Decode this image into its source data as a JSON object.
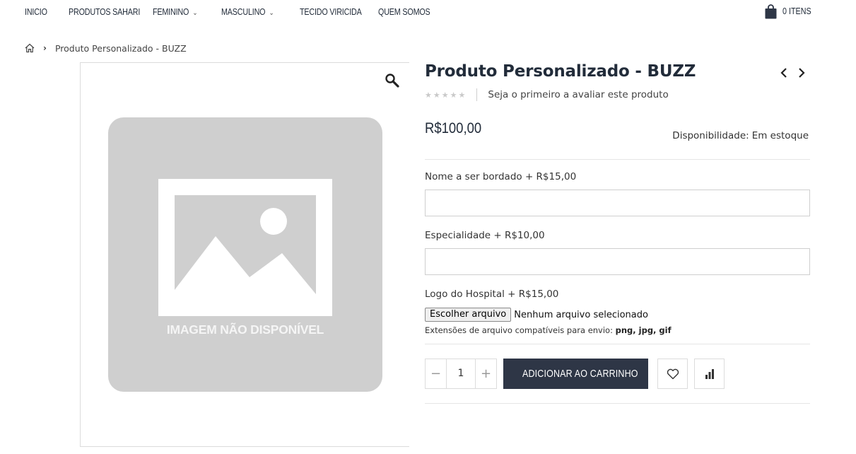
{
  "nav": {
    "items": [
      {
        "label": "INICIO",
        "dropdown": false
      },
      {
        "label": "PRODUTOS SAHARI",
        "dropdown": false
      },
      {
        "label": "FEMININO",
        "dropdown": true
      },
      {
        "label": "MASCULINO",
        "dropdown": true
      },
      {
        "label": "TECIDO VIRICIDA",
        "dropdown": false
      },
      {
        "label": "QUEM SOMOS",
        "dropdown": false
      }
    ],
    "cart_label": "0 ITENS",
    "cart_icon": "shopping-bag-icon"
  },
  "breadcrumb": {
    "home_icon": "home-icon",
    "current": "Produto Personalizado - BUZZ"
  },
  "gallery": {
    "zoom_icon": "magnifier-icon",
    "placeholder_text": "IMAGEM NÃO DISPONÍVEL"
  },
  "product": {
    "title": "Produto Personalizado - BUZZ",
    "rating_stars": 0,
    "rating_max": 5,
    "review_link": "Seja o primeiro a avaliar este produto",
    "price": "R$100,00",
    "availability_label": "Disponibilidade:",
    "availability_value": "Em estoque"
  },
  "options": {
    "name_label": "Nome a ser bordado + R$15,00",
    "name_value": "",
    "specialty_label": "Especialidade + R$10,00",
    "specialty_value": "",
    "logo_label": "Logo do Hospital + R$15,00",
    "file_button": "Escolher arquivo",
    "file_status": "Nenhum arquivo selecionado",
    "file_hint_prefix": "Extensões de arquivo compatíveis para envio:",
    "file_hint_types": "png, jpg, gif"
  },
  "purchase": {
    "quantity": "1",
    "minus": "−",
    "plus": "+",
    "add_to_cart": "ADICIONAR AO CARRINHO"
  },
  "colors": {
    "primary_dark": "#2e3646",
    "placeholder_gray": "#cfcfcf",
    "text_dark": "#222c3a"
  }
}
